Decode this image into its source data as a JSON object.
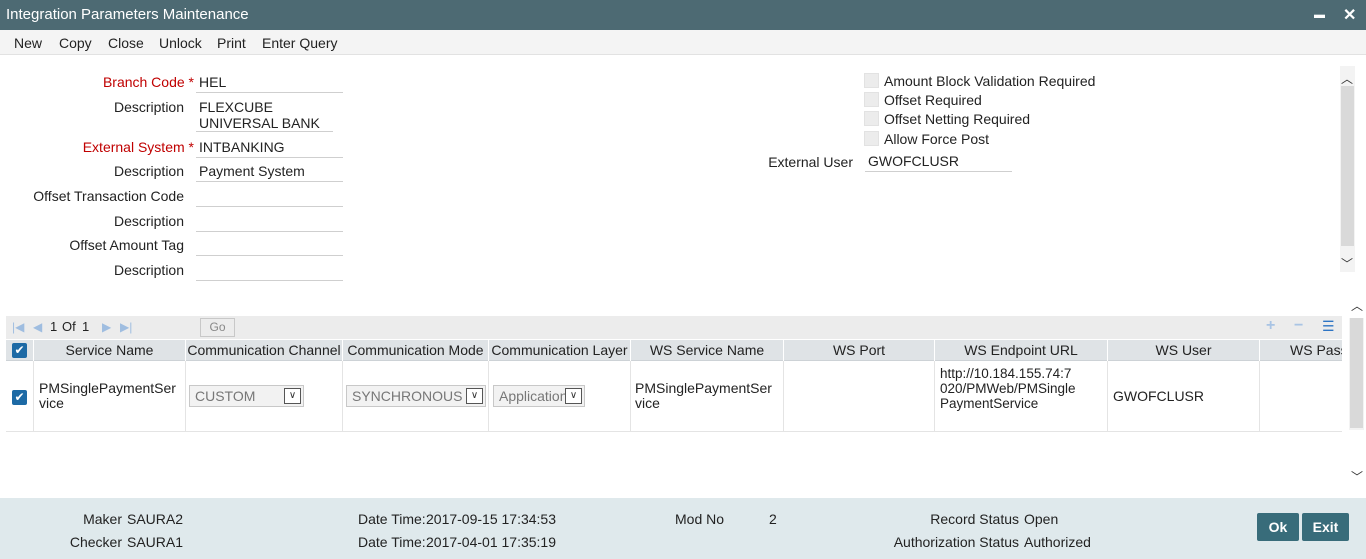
{
  "window": {
    "title": "Integration Parameters Maintenance",
    "minimize": "▬",
    "close": "✕"
  },
  "toolbar": {
    "new": "New",
    "copy": "Copy",
    "close": "Close",
    "unlock": "Unlock",
    "print": "Print",
    "enter_query": "Enter Query"
  },
  "form": {
    "branch_code": {
      "label": "Branch Code",
      "star": "*",
      "value": "HEL"
    },
    "branch_desc": {
      "label": "Description",
      "value_line1": "FLEXCUBE",
      "value_line2": "UNIVERSAL BANK"
    },
    "external_system": {
      "label": "External System",
      "star": "*",
      "value": "INTBANKING"
    },
    "ext_desc": {
      "label": "Description",
      "value": "Payment System"
    },
    "offset_txn_code": {
      "label": "Offset Transaction Code",
      "value": ""
    },
    "offset_txn_desc": {
      "label": "Description",
      "value": ""
    },
    "offset_amount_tag": {
      "label": "Offset Amount Tag",
      "value": ""
    },
    "offset_amt_desc": {
      "label": "Description",
      "value": ""
    },
    "amount_block": "Amount Block Validation Required",
    "offset_required": "Offset Required",
    "offset_netting": "Offset Netting Required",
    "allow_force_post": "Allow Force Post",
    "external_user": {
      "label": "External User",
      "value": "GWOFCLUSR"
    }
  },
  "grid": {
    "page_current": "1",
    "page_of": "Of",
    "page_total": "1",
    "go": "Go",
    "add": "+",
    "remove": "−",
    "view": "☰",
    "headers": [
      "Service Name",
      "Communication Channel",
      "Communication Mode",
      "Communication Layer",
      "WS Service Name",
      "WS Port",
      "WS Endpoint URL",
      "WS User",
      "WS Pass"
    ],
    "row": {
      "service_name_1": "PMSinglePaymentSer",
      "service_name_2": "vice",
      "channel": "CUSTOM",
      "mode": "SYNCHRONOUS",
      "layer": "Application",
      "ws_service_1": "PMSinglePaymentSer",
      "ws_service_2": "vice",
      "ws_port": "",
      "endpoint_1": "http://10.184.155.74:7",
      "endpoint_2": "020/PMWeb/PMSingle",
      "endpoint_3": "PaymentService",
      "ws_user": "GWOFCLUSR"
    }
  },
  "footer": {
    "maker_label": "Maker",
    "maker": "SAURA2",
    "checker_label": "Checker",
    "checker": "SAURA1",
    "dt1_label": "Date Time:",
    "dt1": "2017-09-15 17:34:53",
    "dt2_label": "Date Time:",
    "dt2": "2017-04-01 17:35:19",
    "mod_label": "Mod No",
    "mod": "2",
    "record_status_label": "Record Status",
    "record_status": "Open",
    "auth_status_label": "Authorization Status",
    "auth_status": "Authorized",
    "ok": "Ok",
    "exit": "Exit"
  },
  "colors": {
    "titlebar": "#4d6a73",
    "required": "#c00000",
    "button": "#386c7a",
    "footer": "#dfe9ec",
    "checkbox_checked": "#1d6aa5"
  }
}
